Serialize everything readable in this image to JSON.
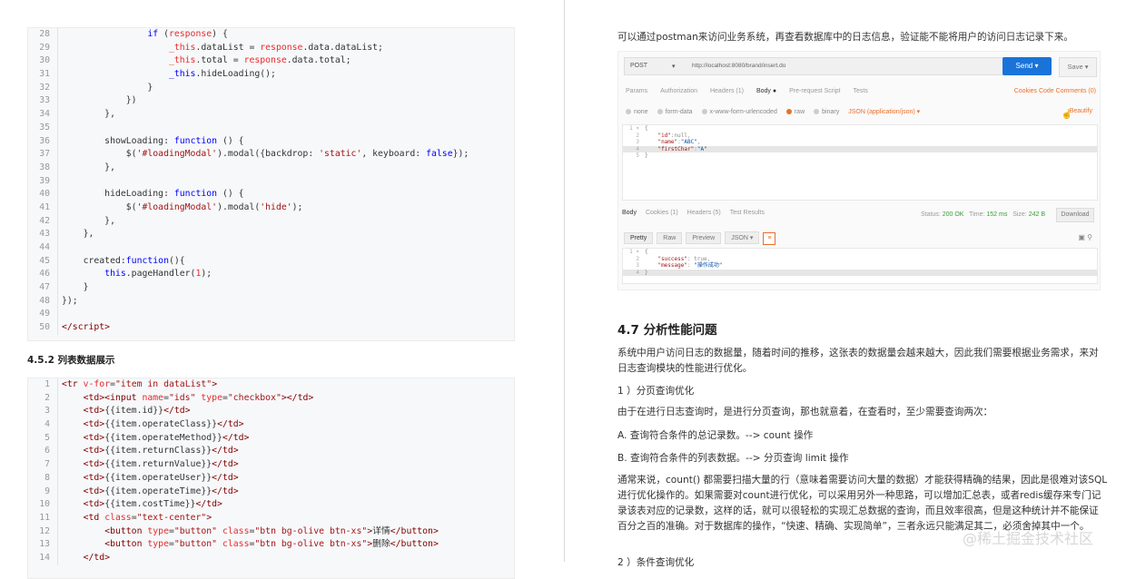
{
  "left": {
    "code_block_1": [
      {
        "n": "28",
        "html": "                <span class=\"k\">if</span> (<span class=\"a\">response</span>) {"
      },
      {
        "n": "29",
        "html": "                    <span class=\"a\">_this</span>.dataList = <span class=\"a\">response</span>.data.dataList;"
      },
      {
        "n": "30",
        "html": "                    <span class=\"a\">_this</span>.total = <span class=\"a\">response</span>.data.total;"
      },
      {
        "n": "31",
        "html": "                    <span class=\"k\">_this</span>.hideLoading();"
      },
      {
        "n": "32",
        "html": "                }"
      },
      {
        "n": "33",
        "html": "            })"
      },
      {
        "n": "34",
        "html": "        },"
      },
      {
        "n": "35",
        "html": ""
      },
      {
        "n": "36",
        "html": "        showLoading: <span class=\"k\">function</span> () {"
      },
      {
        "n": "37",
        "html": "            $(<span class=\"s\">'#loadingModal'</span>).modal({backdrop: <span class=\"s\">'static'</span>, keyboard: <span class=\"k\">false</span>});"
      },
      {
        "n": "38",
        "html": "        },"
      },
      {
        "n": "39",
        "html": ""
      },
      {
        "n": "40",
        "html": "        hideLoading: <span class=\"k\">function</span> () {"
      },
      {
        "n": "41",
        "html": "            $(<span class=\"s\">'#loadingModal'</span>).modal(<span class=\"s\">'hide'</span>);"
      },
      {
        "n": "42",
        "html": "        },"
      },
      {
        "n": "43",
        "html": "    },"
      },
      {
        "n": "44",
        "html": ""
      },
      {
        "n": "45",
        "html": "    created:<span class=\"k\">function</span>(){"
      },
      {
        "n": "46",
        "html": "        <span class=\"k\">this</span>.pageHandler(<span class=\"a\">1</span>);"
      },
      {
        "n": "47",
        "html": "    }"
      },
      {
        "n": "48",
        "html": "});"
      },
      {
        "n": "49",
        "html": ""
      },
      {
        "n": "50",
        "html": "<span class=\"t\">&lt;/script&gt;</span>"
      }
    ],
    "section_title": "4.5.2 列表数据展示",
    "code_block_2": [
      {
        "n": "1",
        "html": "<span class=\"t\">&lt;tr</span> <span class=\"a\">v-for</span>=<span class=\"s\">\"item in dataList\"</span><span class=\"t\">&gt;</span>"
      },
      {
        "n": "2",
        "html": "    <span class=\"t\">&lt;td&gt;&lt;input</span> <span class=\"a\">name</span>=<span class=\"s\">\"ids\"</span> <span class=\"a\">type</span>=<span class=\"s\">\"checkbox\"</span><span class=\"t\">&gt;&lt;/td&gt;</span>"
      },
      {
        "n": "3",
        "html": "    <span class=\"t\">&lt;td&gt;</span>{{item.id}}<span class=\"t\">&lt;/td&gt;</span>"
      },
      {
        "n": "4",
        "html": "    <span class=\"t\">&lt;td&gt;</span>{{item.operateClass}}<span class=\"t\">&lt;/td&gt;</span>"
      },
      {
        "n": "5",
        "html": "    <span class=\"t\">&lt;td&gt;</span>{{item.operateMethod}}<span class=\"t\">&lt;/td&gt;</span>"
      },
      {
        "n": "6",
        "html": "    <span class=\"t\">&lt;td&gt;</span>{{item.returnClass}}<span class=\"t\">&lt;/td&gt;</span>"
      },
      {
        "n": "7",
        "html": "    <span class=\"t\">&lt;td&gt;</span>{{item.returnValue}}<span class=\"t\">&lt;/td&gt;</span>"
      },
      {
        "n": "8",
        "html": "    <span class=\"t\">&lt;td&gt;</span>{{item.operateUser}}<span class=\"t\">&lt;/td&gt;</span>"
      },
      {
        "n": "9",
        "html": "    <span class=\"t\">&lt;td&gt;</span>{{item.operateTime}}<span class=\"t\">&lt;/td&gt;</span>"
      },
      {
        "n": "10",
        "html": "    <span class=\"t\">&lt;td&gt;</span>{{item.costTime}}<span class=\"t\">&lt;/td&gt;</span>"
      },
      {
        "n": "11",
        "html": "    <span class=\"t\">&lt;td</span> <span class=\"a\">class</span>=<span class=\"s\">\"text-center\"</span><span class=\"t\">&gt;</span>"
      },
      {
        "n": "12",
        "html": "        <span class=\"t\">&lt;button</span> <span class=\"a\">type</span>=<span class=\"s\">\"button\"</span> <span class=\"a\">class</span>=<span class=\"s\">\"btn bg-olive btn-xs\"</span><span class=\"t\">&gt;</span>详情<span class=\"t\">&lt;/button&gt;</span>"
      },
      {
        "n": "13",
        "html": "        <span class=\"t\">&lt;button</span> <span class=\"a\">type</span>=<span class=\"s\">\"button\"</span> <span class=\"a\">class</span>=<span class=\"s\">\"btn bg-olive btn-xs\"</span><span class=\"t\">&gt;</span>删除<span class=\"t\">&lt;/button&gt;</span>"
      },
      {
        "n": "14",
        "html": "    <span class=\"t\">&lt;/td&gt;</span>"
      }
    ]
  },
  "right": {
    "intro": "可以通过postman来访问业务系统，再查看数据库中的日志信息，验证能不能将用户的访问日志记录下来。",
    "postman": {
      "method": "POST",
      "url": "http://localhost:8080/brand/insert.do",
      "send": "Send",
      "save": "Save",
      "tabs": [
        "Params",
        "Authorization",
        "Headers (1)",
        "Body ●",
        "Pre-request Script",
        "Tests"
      ],
      "active_tab": "Body ●",
      "right_links": "Cookies  Code  Comments (0)",
      "body_types": [
        "none",
        "form-data",
        "x-www-form-urlencoded",
        "raw",
        "binary"
      ],
      "content_type": "JSON (application/json) ▾",
      "beautify": "Beautify",
      "request_lines": [
        {
          "n": "1 ▾",
          "html": "{"
        },
        {
          "n": "2",
          "html": "    <span class=\"jk\">\"id\"</span>:null,"
        },
        {
          "n": "3",
          "html": "    <span class=\"jk\">\"name\"</span>:<span class=\"js\">\"ABC\"</span>,"
        },
        {
          "n": "4",
          "html": "    <span class=\"jk\">\"firstChar\"</span>:<span class=\"js\">\"A\"</span>"
        },
        {
          "n": "5",
          "html": "}"
        }
      ],
      "response_tabs": [
        "Body",
        "Cookies (1)",
        "Headers (5)",
        "Test Results"
      ],
      "status_label": "Status:",
      "status_value": "200 OK",
      "time_label": "Time:",
      "time_value": "152 ms",
      "size_label": "Size:",
      "size_value": "242 B",
      "download": "Download",
      "view_modes": [
        "Pretty",
        "Raw",
        "Preview"
      ],
      "format": "JSON ▾",
      "response_lines": [
        {
          "n": "1 ▾",
          "html": "{"
        },
        {
          "n": "2",
          "html": "    <span class=\"jk\">\"success\"</span>: true,"
        },
        {
          "n": "3",
          "html": "    <span class=\"jk\">\"message\"</span>: <span class=\"js\">\"操作成功\"</span>"
        },
        {
          "n": "4",
          "html": "}"
        }
      ]
    },
    "heading": "4.7 分析性能问题",
    "p1": "系统中用户访问日志的数据量，随着时间的推移，这张表的数据量会越来越大，因此我们需要根据业务需求，来对日志查询模块的性能进行优化。",
    "p2": "1 ）分页查询优化",
    "p3": "由于在进行日志查询时，是进行分页查询，那也就意着，在查看时，至少需要查询两次：",
    "p4": "A. 查询符合条件的总记录数。--> count 操作",
    "p5": "B. 查询符合条件的列表数据。--> 分页查询 limit 操作",
    "p6": "通常来说，count() 都需要扫描大量的行（意味着需要访问大量的数据）才能获得精确的结果，因此是很难对该SQL进行优化操作的。如果需要对count进行优化，可以采用另外一种思路，可以增加汇总表，或者redis缓存来专门记录该表对应的记录数，这样的话，就可以很轻松的实现汇总数据的查询，而且效率很高，但是这种统计并不能保证百分之百的准确。对于数据库的操作，“快速、精确、实现简单”，三者永远只能满足其二，必须舍掉其中一个。",
    "p7": "2 ）条件查询优化"
  },
  "watermark": "@稀土掘金技术社区"
}
